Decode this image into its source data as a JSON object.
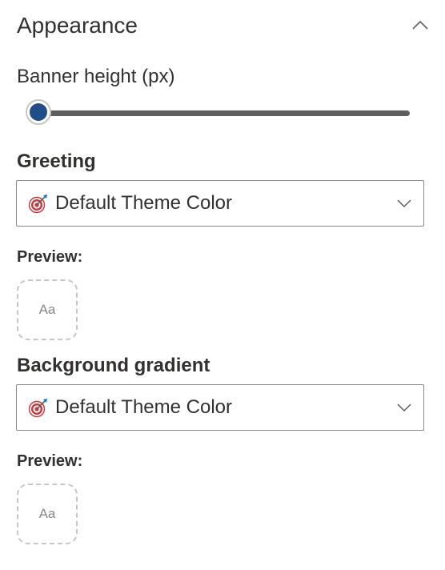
{
  "section": {
    "title": "Appearance",
    "collapse_icon": "chevron-up-icon"
  },
  "banner_height": {
    "label": "Banner height (px)",
    "value_fraction": 0.0
  },
  "greeting": {
    "label": "Greeting",
    "selected": "Default Theme Color",
    "icon": "target-dart-icon",
    "preview_label": "Preview:",
    "preview_text": "Aa"
  },
  "background_gradient": {
    "label": "Background gradient",
    "selected": "Default Theme Color",
    "icon": "target-dart-icon",
    "preview_label": "Preview:",
    "preview_text": "Aa"
  },
  "colors": {
    "text": "#323130",
    "slider_track": "#605e5c",
    "slider_thumb": "#1f4e89",
    "border": "#8a8886",
    "dashed_border": "#c8c6c4",
    "icon_red": "#d13438"
  }
}
